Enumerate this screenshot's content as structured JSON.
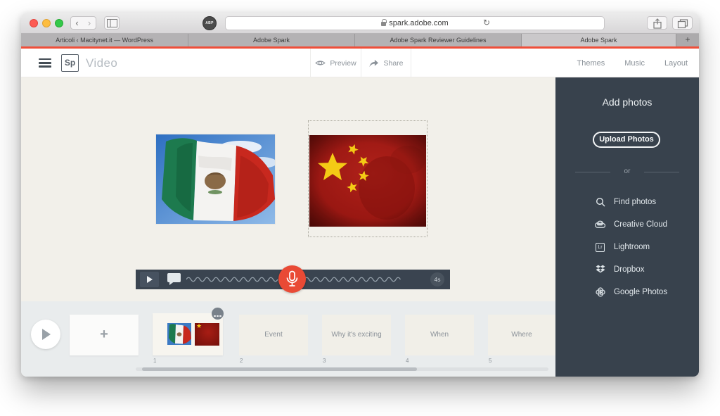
{
  "browser": {
    "back_glyph": "‹",
    "forward_glyph": "›",
    "adblock_label": "ABP",
    "url": "spark.adobe.com",
    "refresh_glyph": "↻",
    "tabs": [
      {
        "title": "Articoli ‹ Macitynet.it — WordPress",
        "active": false
      },
      {
        "title": "Adobe Spark",
        "active": false
      },
      {
        "title": "Adobe Spark Reviewer Guidelines",
        "active": false
      },
      {
        "title": "Adobe Spark",
        "active": true
      }
    ],
    "new_tab_glyph": "+"
  },
  "header": {
    "logo": "Sp",
    "app_title": "Video",
    "preview_label": "Preview",
    "share_label": "Share",
    "themes_label": "Themes",
    "music_label": "Music",
    "layout_label": "Layout"
  },
  "canvas": {
    "slide_photos": [
      "mexico-flag-photo",
      "china-flag-photo"
    ]
  },
  "playback": {
    "duration": "4s"
  },
  "sidebar": {
    "title": "Add photos",
    "upload_label": "Upload Photos",
    "divider_label": "or",
    "items": [
      {
        "label": "Find photos",
        "icon": "search-icon"
      },
      {
        "label": "Creative Cloud",
        "icon": "creative-cloud-icon"
      },
      {
        "label": "Lightroom",
        "icon": "lightroom-icon",
        "badge": "Lr"
      },
      {
        "label": "Dropbox",
        "icon": "dropbox-icon"
      },
      {
        "label": "Google Photos",
        "icon": "google-photos-icon"
      }
    ]
  },
  "timeline": {
    "add_glyph": "+",
    "slides": [
      {
        "number": "1"
      },
      {
        "number": "2",
        "label": "Event"
      },
      {
        "number": "3",
        "label": "Why it's exciting"
      },
      {
        "number": "4",
        "label": "When"
      },
      {
        "number": "5",
        "label": "Where"
      }
    ]
  },
  "colors": {
    "accent_red": "#e94a35",
    "top_line_red": "#ef4f3a",
    "sidebar_bg": "#38424d",
    "canvas_cream": "#f2f0ea"
  }
}
